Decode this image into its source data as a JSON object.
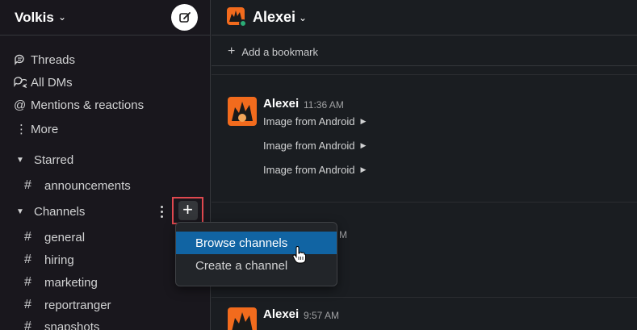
{
  "workspace": {
    "name": "Volkis"
  },
  "sidebar": {
    "nav": [
      {
        "label": "Threads",
        "icon": "threads-icon"
      },
      {
        "label": "All DMs",
        "icon": "dms-icon"
      },
      {
        "label": "Mentions & reactions",
        "icon": "mention-icon"
      },
      {
        "label": "More",
        "icon": "more-icon"
      }
    ],
    "starred": {
      "label": "Starred",
      "channels": [
        "announcements"
      ]
    },
    "channels": {
      "label": "Channels",
      "items": [
        "general",
        "hiring",
        "marketing",
        "reportranger",
        "snapshots"
      ]
    }
  },
  "main": {
    "dm_name": "Alexei",
    "bookmark_label": "Add a bookmark",
    "messages": [
      {
        "author": "Alexei",
        "time": "11:36 AM",
        "lines": [
          "Image from Android",
          "Image from Android",
          "Image from Android"
        ]
      },
      {
        "time_fragment": "M"
      },
      {
        "author": "Alexei",
        "time": "9:57 AM"
      }
    ]
  },
  "dropdown": {
    "items": [
      "Browse channels",
      "Create a channel"
    ]
  },
  "colors": {
    "accent": "#1164a3",
    "highlight_border": "#e0484f",
    "online": "#2bac76",
    "avatar_bg": "#f26b1d"
  }
}
